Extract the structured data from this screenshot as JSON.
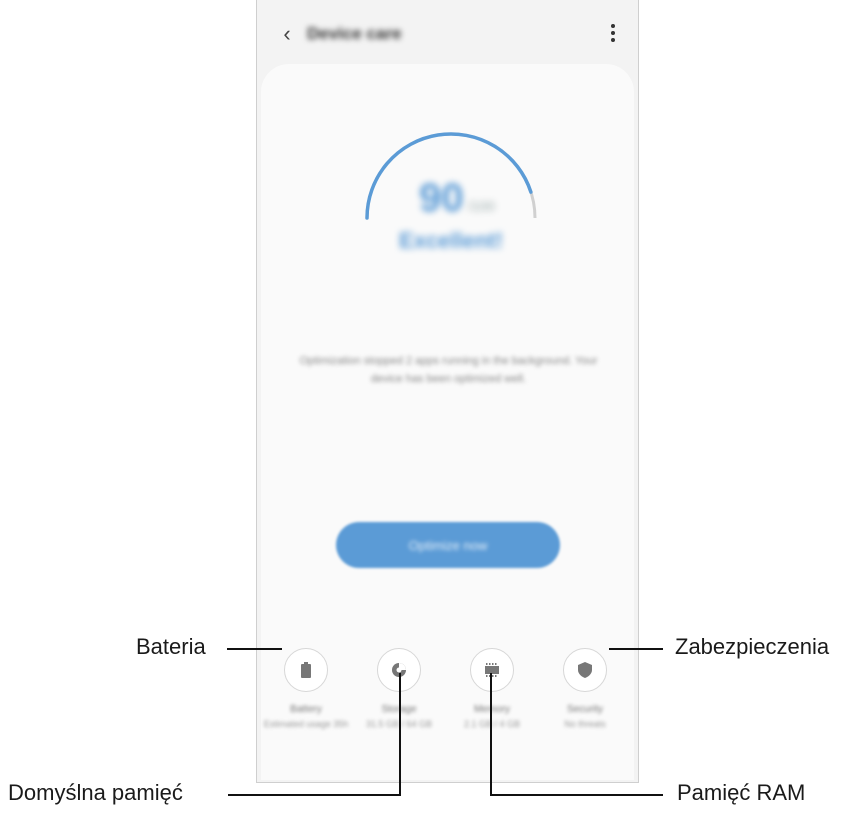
{
  "app": {
    "title": "Device care",
    "back_icon": "chevron-left-icon",
    "more_icon": "more-vertical-icon"
  },
  "score": {
    "value": "90",
    "unit": "/100",
    "status": "Excellent!",
    "level": 0.9
  },
  "description": "Optimization stopped 2 apps running in the background. Your device has been optimized well.",
  "optimize_button": "Optimize now",
  "features": [
    {
      "name": "Battery",
      "sub": "Estimated usage 35h",
      "icon": "battery-icon"
    },
    {
      "name": "Storage",
      "sub": "31.5 GB / 64 GB",
      "icon": "storage-pie-icon"
    },
    {
      "name": "Memory",
      "sub": "2.1 GB / 4 GB",
      "icon": "memory-chip-icon"
    },
    {
      "name": "Security",
      "sub": "No threats",
      "icon": "shield-icon"
    }
  ],
  "callouts": {
    "battery": "Bateria",
    "storage": "Domyślna pamięć",
    "memory": "Pamięć RAM",
    "security": "Zabezpieczenia"
  },
  "colors": {
    "accent": "#5b9bd6",
    "gauge_track": "#d0d0d0"
  }
}
